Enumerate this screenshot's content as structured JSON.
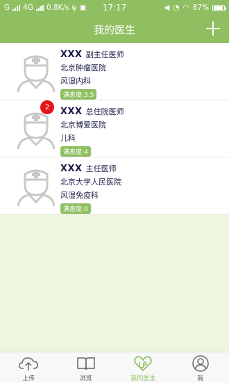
{
  "status_bar": {
    "carrier_left": "G",
    "network": "4G",
    "speed": "0.8K/s",
    "time": "17:17",
    "battery": "87%"
  },
  "header": {
    "title": "我的医生"
  },
  "doctors": [
    {
      "name": "XXX",
      "title": "副主任医师",
      "hospital": "北京肿瘤医院",
      "department": "风湿内科",
      "satisfaction": "满意度:3.5",
      "badge": ""
    },
    {
      "name": "XXX",
      "title": "总住院医师",
      "hospital": "北京博爱医院",
      "department": "儿科",
      "satisfaction": "满意度:4",
      "badge": "2"
    },
    {
      "name": "XXX",
      "title": "主任医师",
      "hospital": "北京大学人民医院",
      "department": "风湿免疫科",
      "satisfaction": "满意度:0",
      "badge": ""
    }
  ],
  "tabs": [
    {
      "label": "上传",
      "icon": "upload-cloud-icon",
      "active": false
    },
    {
      "label": "浏览",
      "icon": "book-icon",
      "active": false
    },
    {
      "label": "我的医生",
      "icon": "doctor-heart-icon",
      "active": true
    },
    {
      "label": "我",
      "icon": "user-icon",
      "active": false
    }
  ],
  "colors": {
    "accent": "#8fbf60",
    "badge": "#e4161b",
    "text": "#1c1c4a",
    "background": "#eef6df"
  }
}
